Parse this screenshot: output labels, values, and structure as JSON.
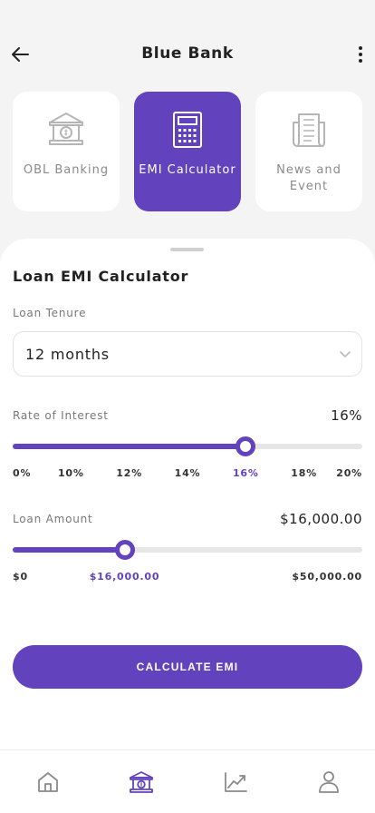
{
  "header": {
    "title": "Blue Bank"
  },
  "cards": [
    {
      "label": "OBL Banking",
      "icon": "bank-icon",
      "active": false
    },
    {
      "label": "EMI Calculator",
      "icon": "calculator-icon",
      "active": true
    },
    {
      "label": "News and Event",
      "icon": "newspaper-icon",
      "active": false
    }
  ],
  "calculator": {
    "title": "Loan EMI Calculator",
    "tenure": {
      "label": "Loan Tenure",
      "value": "12 months"
    },
    "interest": {
      "label": "Rate of Interest",
      "value_text": "16%",
      "value": 16,
      "min": 0,
      "max": 20,
      "ticks": [
        "0%",
        "10%",
        "12%",
        "14%",
        "16%",
        "18%",
        "20%"
      ],
      "selected_tick": "16%"
    },
    "amount": {
      "label": "Loan Amount",
      "value_text": "$16,000.00",
      "value": 16000,
      "min": 0,
      "max": 50000,
      "ticks": {
        "min": "$0",
        "current": "$16,000.00",
        "max": "$50,000.00"
      }
    },
    "cta_label": "CALCULATE EMI"
  },
  "nav": [
    {
      "name": "home",
      "icon": "home-icon",
      "active": false
    },
    {
      "name": "bank",
      "icon": "bank-icon",
      "active": true
    },
    {
      "name": "analytics",
      "icon": "chart-icon",
      "active": false
    },
    {
      "name": "profile",
      "icon": "user-icon",
      "active": false
    }
  ],
  "colors": {
    "accent": "#6342bd",
    "background": "#f4f4f4",
    "inactive_icon": "#8a8a8a"
  }
}
